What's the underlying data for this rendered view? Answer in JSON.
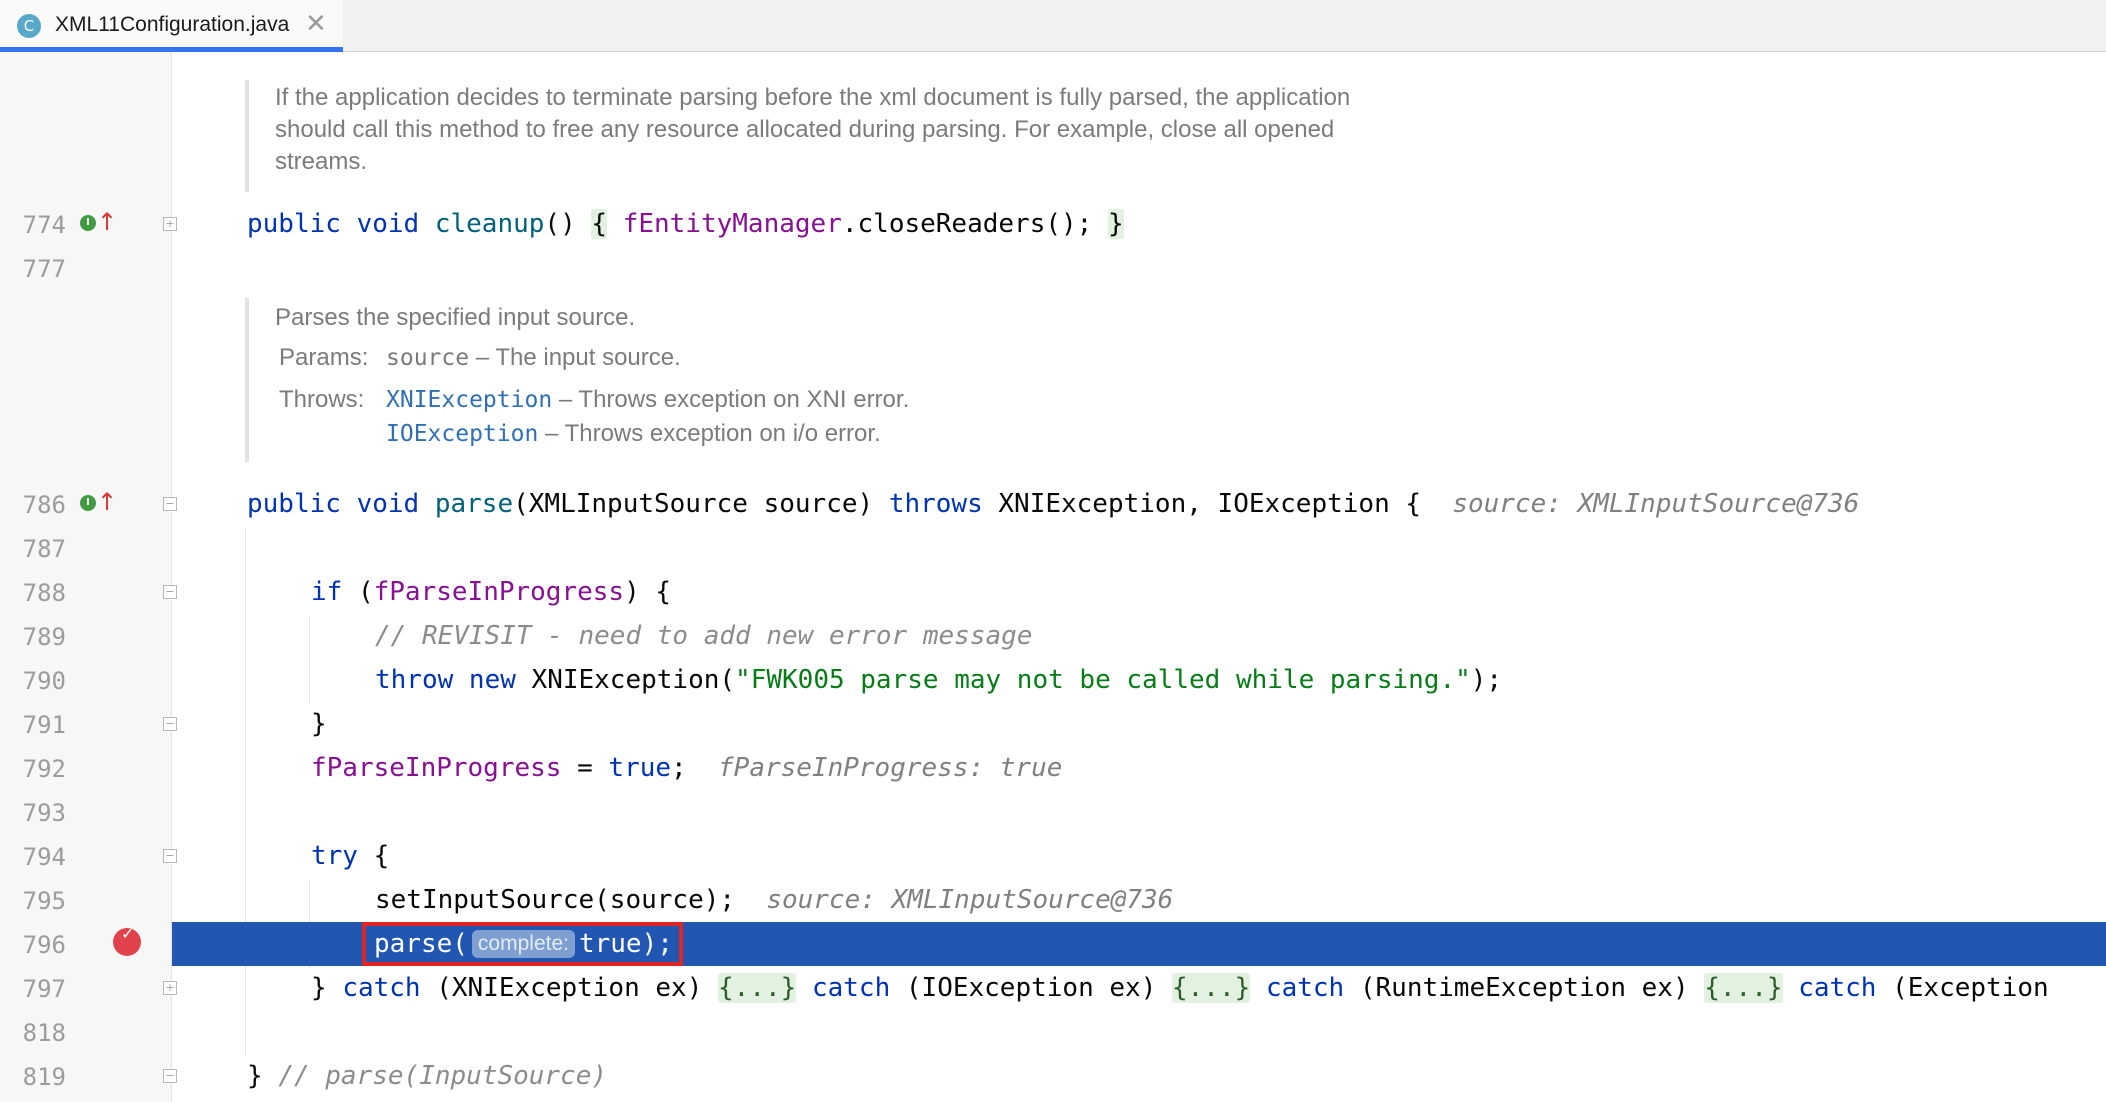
{
  "tab": {
    "icon": "C",
    "title": "XML11Configuration.java",
    "close": "✕"
  },
  "doc_cleanup": {
    "text": "If the application decides to terminate parsing before the xml document is fully parsed, the application should call this method to free any resource allocated during parsing. For example, close all opened streams.",
    "lines": [
      "If the application decides to terminate parsing before the xml document is fully parsed, the application",
      "should call this method to free any resource allocated during parsing. For example, close all opened",
      "streams."
    ]
  },
  "doc_parse": {
    "summary": "Parses the specified input source.",
    "params_label": "Params:",
    "param_name": "source",
    "param_desc": "– The input source.",
    "throws_label": "Throws:",
    "throws": [
      {
        "type": "XNIException",
        "desc": "– Throws exception on XNI error."
      },
      {
        "type": "IOException",
        "desc": "– Throws exception on i/o error."
      }
    ]
  },
  "lines": {
    "774": "774",
    "777": "777",
    "786": "786",
    "787": "787",
    "788": "788",
    "789": "789",
    "790": "790",
    "791": "791",
    "792": "792",
    "793": "793",
    "794": "794",
    "795": "795",
    "796": "796",
    "797": "797",
    "818": "818",
    "819": "819"
  },
  "code": {
    "l774": {
      "kw": "public void ",
      "method": "cleanup",
      "paren": "() ",
      "brace_open": "{",
      "field": "fEntityManager",
      "rest": ".closeReaders(); ",
      "brace_close": "}"
    },
    "l786": {
      "kw1": "public void ",
      "method": "parse",
      "mid": "(XMLInputSource source) ",
      "kw2": "throws",
      "rest": " XNIException, IOException {",
      "hint": "source: XMLInputSource@736"
    },
    "l788": {
      "kw": "if",
      "open": " (",
      "field": "fParseInProgress",
      "rest": ") {"
    },
    "l789": {
      "comment": "// REVISIT - need to add new error message"
    },
    "l790": {
      "kw": "throw new",
      "mid": " XNIException(",
      "string": "\"FWK005 parse may not be called while parsing.\"",
      "rest": ");"
    },
    "l791": {
      "text": "}"
    },
    "l792": {
      "field": "fParseInProgress",
      "mid": " = ",
      "kw": "true",
      "rest": ";",
      "hint": "fParseInProgress: true"
    },
    "l794": {
      "kw": "try",
      "rest": " {"
    },
    "l795": {
      "text": "setInputSource(source);",
      "hint": "source: XMLInputSource@736"
    },
    "l796": {
      "pre": "parse(",
      "param_hint": "complete:",
      "post": "true);"
    },
    "l797": {
      "brace": "} ",
      "catch_kw": "catch",
      "c1": " (XNIException ex) ",
      "c2": " (IOException ex) ",
      "c3": " (RuntimeException ex) ",
      "c4": " (Exception",
      "folded": "{...}"
    },
    "l819": {
      "brace": "} ",
      "comment": "// parse(InputSource)"
    }
  }
}
